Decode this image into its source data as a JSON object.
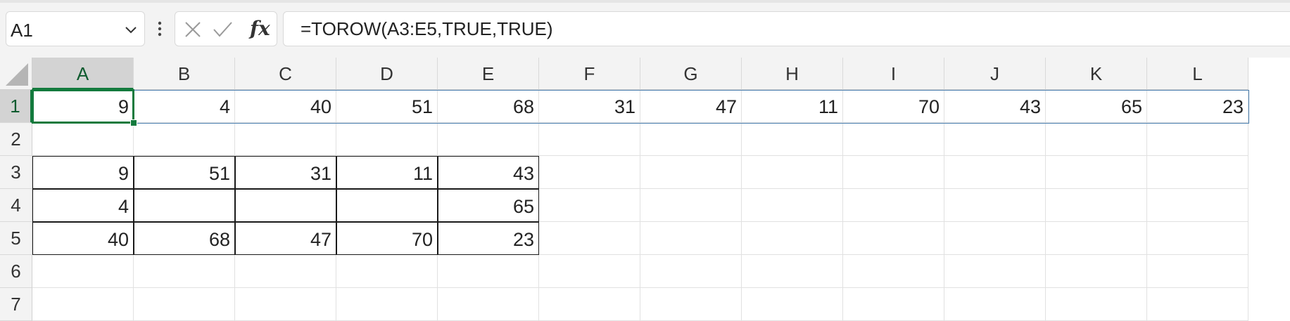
{
  "name_box": {
    "value": "A1"
  },
  "formula_bar": {
    "formula": "=TOROW(A3:E5,TRUE,TRUE)",
    "fx_label": "fx"
  },
  "columns": [
    "A",
    "B",
    "C",
    "D",
    "E",
    "F",
    "G",
    "H",
    "I",
    "J",
    "K",
    "L"
  ],
  "rows": [
    "1",
    "2",
    "3",
    "4",
    "5",
    "6",
    "7"
  ],
  "selection": {
    "active_cell": "A1",
    "active_column": "A",
    "active_row": "1"
  },
  "cells": {
    "row1": [
      "9",
      "4",
      "40",
      "51",
      "68",
      "31",
      "47",
      "11",
      "70",
      "43",
      "65",
      "23"
    ],
    "row3": [
      "9",
      "51",
      "31",
      "11",
      "43"
    ],
    "row4": [
      "4",
      "",
      "",
      "",
      "65"
    ],
    "row5": [
      "40",
      "68",
      "47",
      "70",
      "23"
    ]
  },
  "colors": {
    "accent": "#137a3d",
    "spill_border": "#4a7fb0"
  },
  "icons": {
    "cancel": "x-icon",
    "enter": "checkmark-icon",
    "namebox_dropdown": "chevron-down-icon",
    "more": "vertical-ellipsis-icon"
  }
}
